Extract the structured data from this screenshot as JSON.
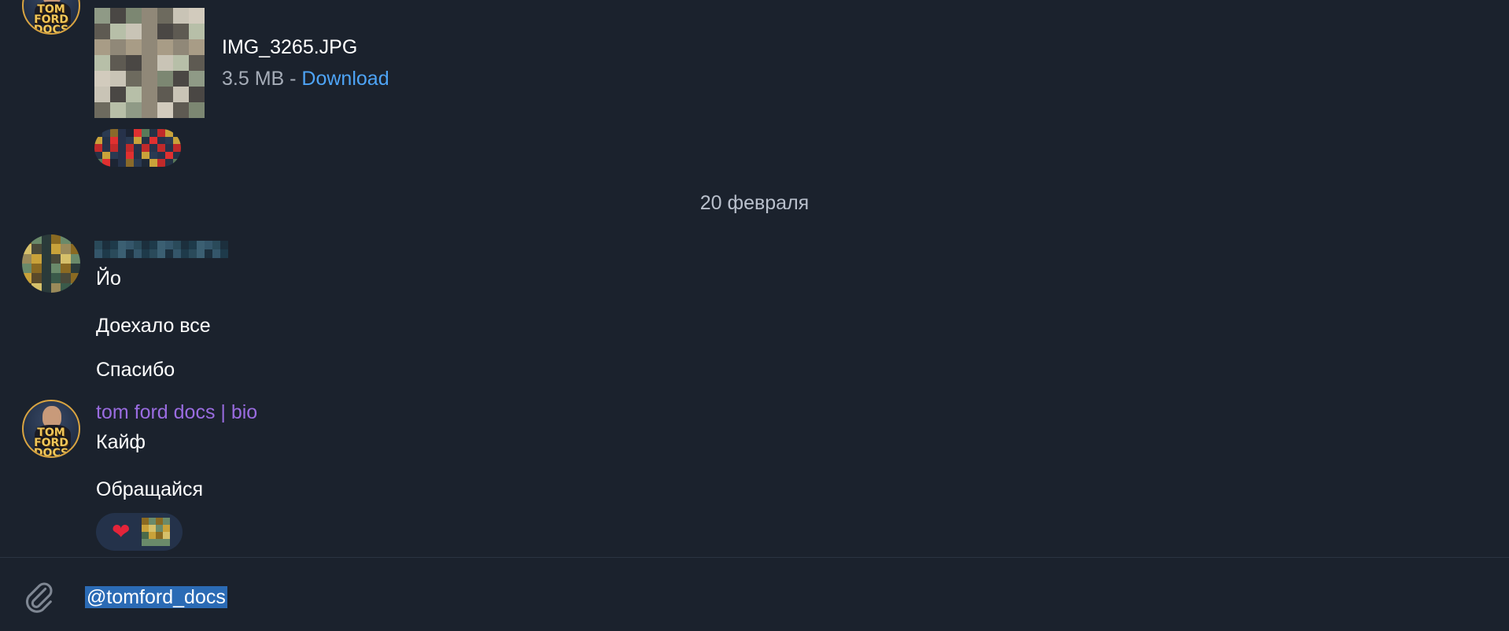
{
  "file_message": {
    "file_name": "IMG_3265.JPG",
    "file_size": "3.5 MB",
    "separator": " - ",
    "download_label": "Download",
    "avatar_text": "TOM FORD DOCS"
  },
  "date_separator": "20 февраля",
  "user_message": {
    "lines": [
      "Йо",
      "Доехало все",
      "Спасибо"
    ]
  },
  "channel_message": {
    "sender_name": "tom ford docs | bio",
    "lines": [
      "Кайф",
      "Обращайся"
    ],
    "reaction_emoji": "❤",
    "avatar_text": "TOM FORD DOCS"
  },
  "composer": {
    "input_value": "@tomford_docs"
  },
  "colors": {
    "background": "#1b222d",
    "link": "#4ea4f6",
    "sender": "#9a6ce0",
    "muted": "#a6adb8",
    "selection": "#2b6bb5"
  },
  "icons": {
    "attach": "paperclip-icon",
    "reaction": "heart-icon"
  }
}
